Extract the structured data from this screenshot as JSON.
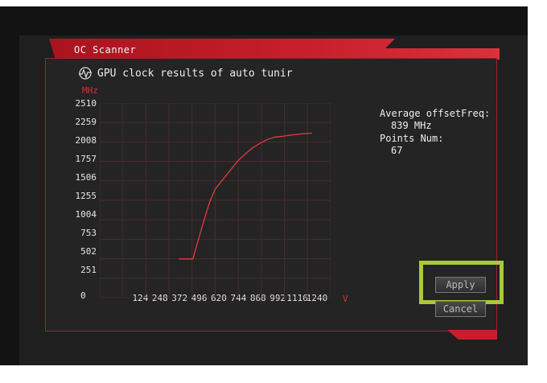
{
  "window": {
    "title": "OC Scanner"
  },
  "heading": {
    "icon": "gpu-waveform-icon",
    "text": "GPU clock results of auto tunir"
  },
  "chart_data": {
    "type": "line",
    "ylabel": "MHz",
    "xlabel": "V",
    "xlim": [
      0,
      1240
    ],
    "ylim": [
      0,
      2510
    ],
    "x_ticks": [
      "0",
      "124",
      "248",
      "372",
      "496",
      "620",
      "744",
      "868",
      "992",
      "1116",
      "1240"
    ],
    "y_ticks": [
      "2510",
      "2259",
      "2008",
      "1757",
      "1506",
      "1255",
      "1004",
      "753",
      "502",
      "251"
    ],
    "series": [
      {
        "color": "#e23b3b",
        "points": [
          [
            425,
            500
          ],
          [
            500,
            500
          ],
          [
            530,
            750
          ],
          [
            560,
            1000
          ],
          [
            590,
            1230
          ],
          [
            620,
            1400
          ],
          [
            660,
            1520
          ],
          [
            700,
            1640
          ],
          [
            740,
            1760
          ],
          [
            780,
            1850
          ],
          [
            820,
            1930
          ],
          [
            860,
            1990
          ],
          [
            900,
            2040
          ],
          [
            940,
            2070
          ],
          [
            980,
            2080
          ],
          [
            1010,
            2090
          ],
          [
            1040,
            2100
          ],
          [
            1080,
            2110
          ],
          [
            1116,
            2120
          ],
          [
            1140,
            2120
          ]
        ]
      }
    ]
  },
  "info": {
    "avg_label": "Average offsetFreq:",
    "avg_value": "839 MHz",
    "points_label": "Points Num:",
    "points_value": "67"
  },
  "buttons": {
    "apply": "Apply",
    "cancel": "Cancel"
  },
  "colors": {
    "accent": "#d6303a",
    "highlight": "#a8c93a"
  }
}
